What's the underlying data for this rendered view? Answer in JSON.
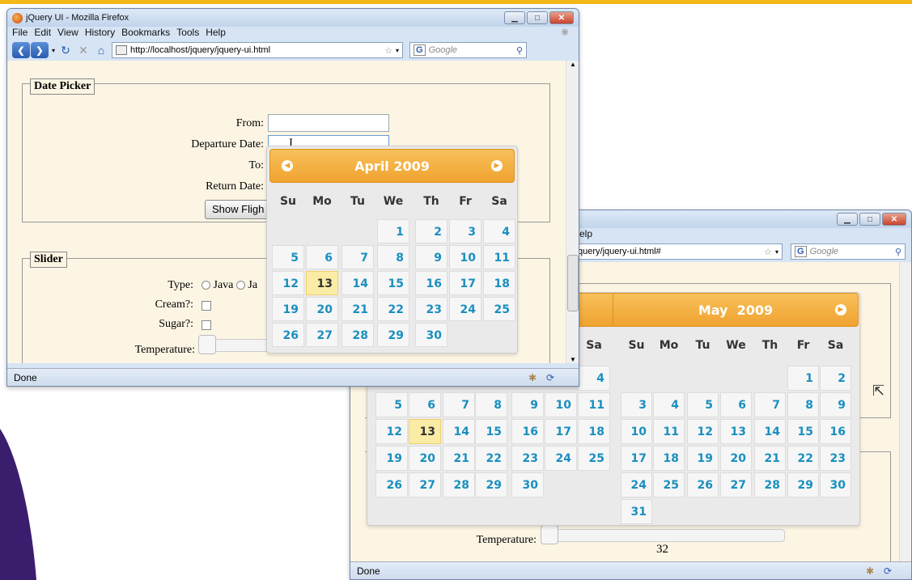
{
  "app": {
    "window_title": "jQuery UI - Mozilla Firefox",
    "menu": [
      "File",
      "Edit",
      "View",
      "History",
      "Bookmarks",
      "Tools",
      "Help"
    ],
    "url": "http://localhost/jquery/jquery-ui.html",
    "url2": "query/jquery-ui.html#",
    "search_placeholder": "Google",
    "status": "Done",
    "menu_tail": "elp"
  },
  "datepicker_form": {
    "legend": "Date Picker",
    "from_label": "From:",
    "departure_label": "Departure Date:",
    "to_label": "To:",
    "return_label": "Return Date:",
    "show_button": "Show Fligh"
  },
  "slider_form": {
    "legend": "Slider",
    "type_label": "Type:",
    "type_options": [
      "Java",
      "Ja"
    ],
    "cream_label": "Cream?:",
    "sugar_label": "Sugar?:",
    "temperature_label": "Temperature:",
    "temperature_label2": "Temperature:",
    "temperature_value": "32"
  },
  "calendar1": {
    "title": "April 2009",
    "dow": [
      "Su",
      "Mo",
      "Tu",
      "We",
      "Th",
      "Fr",
      "Sa"
    ],
    "weeks": [
      [
        "",
        "",
        "",
        "1",
        "2",
        "3",
        "4"
      ],
      [
        "5",
        "6",
        "7",
        "8",
        "9",
        "10",
        "11"
      ],
      [
        "12",
        "13",
        "14",
        "15",
        "16",
        "17",
        "18"
      ],
      [
        "19",
        "20",
        "21",
        "22",
        "23",
        "24",
        "25"
      ],
      [
        "26",
        "27",
        "28",
        "29",
        "30",
        "",
        ""
      ]
    ],
    "today": "13"
  },
  "calendar2_left": {
    "dow_visible": [
      "Sa"
    ],
    "weeks": [
      [
        "",
        "",
        "",
        "",
        "",
        "",
        "4"
      ],
      [
        "5",
        "6",
        "7",
        "8",
        "9",
        "10",
        "11"
      ],
      [
        "12",
        "13",
        "14",
        "15",
        "16",
        "17",
        "18"
      ],
      [
        "19",
        "20",
        "21",
        "22",
        "23",
        "24",
        "25"
      ],
      [
        "26",
        "27",
        "28",
        "29",
        "30",
        "",
        ""
      ]
    ],
    "today": "13"
  },
  "calendar2_right": {
    "title": "May  2009",
    "dow": [
      "Su",
      "Mo",
      "Tu",
      "We",
      "Th",
      "Fr",
      "Sa"
    ],
    "weeks": [
      [
        "",
        "",
        "",
        "",
        "",
        "1",
        "2"
      ],
      [
        "3",
        "4",
        "5",
        "6",
        "7",
        "8",
        "9"
      ],
      [
        "10",
        "11",
        "12",
        "13",
        "14",
        "15",
        "16"
      ],
      [
        "17",
        "18",
        "19",
        "20",
        "21",
        "22",
        "23"
      ],
      [
        "24",
        "25",
        "26",
        "27",
        "28",
        "29",
        "30"
      ],
      [
        "31",
        "",
        "",
        "",
        "",
        "",
        ""
      ]
    ]
  },
  "colors": {
    "accent_orange": "#f0a330",
    "day_text": "#1a8fbf",
    "today_bg": "#fbeca5",
    "page_bg": "#fcf5e4",
    "purple": "#3b1d6e"
  },
  "icons": [
    "firefox-icon",
    "back-icon",
    "forward-icon",
    "reload-icon",
    "stop-icon",
    "home-icon",
    "page-icon",
    "star-icon",
    "search-icon",
    "throbber-icon",
    "addon-icon",
    "sync-icon",
    "cursor-icon"
  ]
}
